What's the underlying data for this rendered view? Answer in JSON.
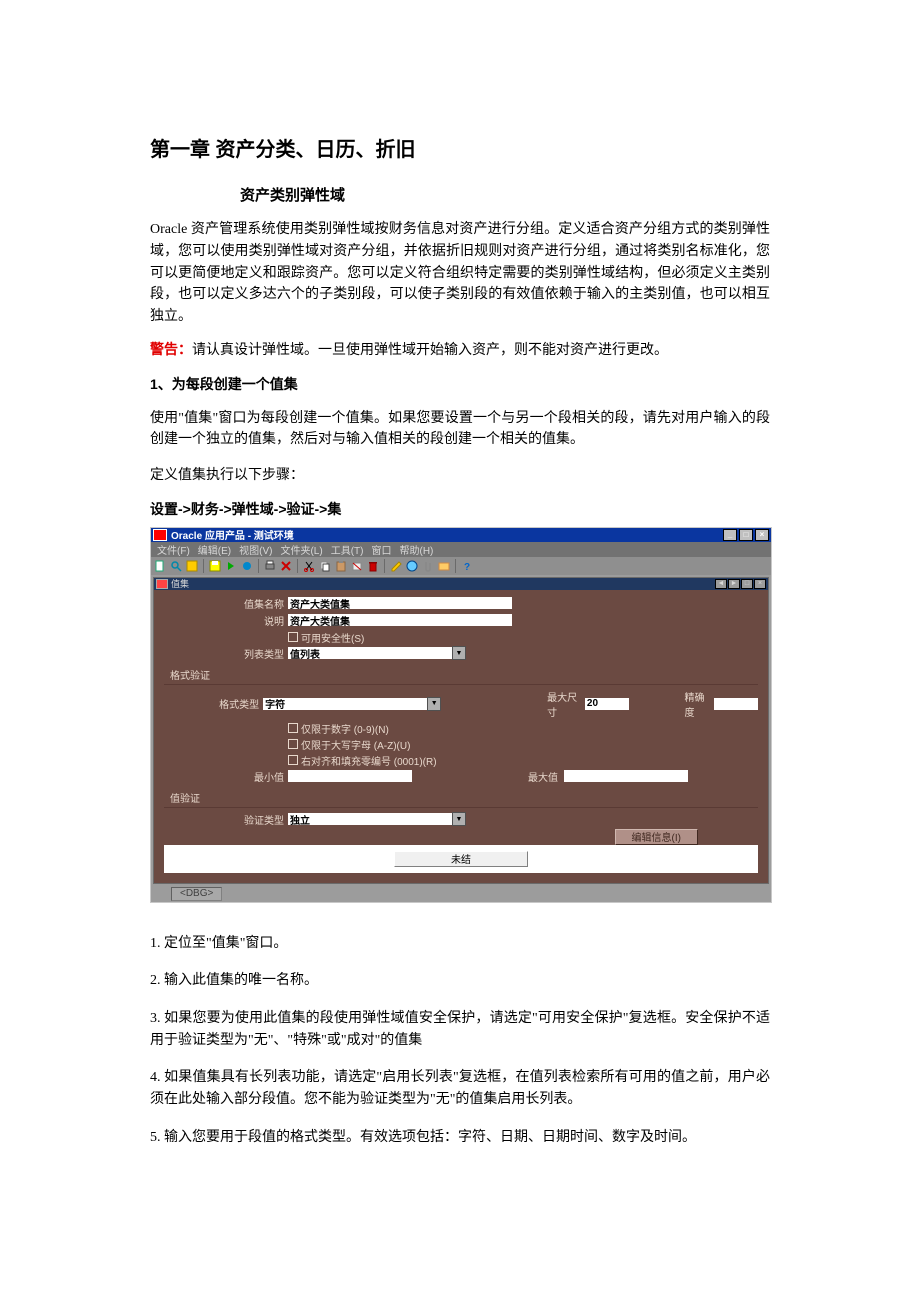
{
  "doc": {
    "chapter_title": "第一章 资产分类、日历、折旧",
    "section_title": "资产类别弹性域",
    "intro_para": "Oracle 资产管理系统使用类别弹性域按财务信息对资产进行分组。定义适合资产分组方式的类别弹性域，您可以使用类别弹性域对资产分组，并依据折旧规则对资产进行分组，通过将类别名标准化，您可以更简便地定义和跟踪资产。您可以定义符合组织特定需要的类别弹性域结构，但必须定义主类别段，也可以定义多达六个的子类别段，可以使子类别段的有效值依赖于输入的主类别值，也可以相互独立。",
    "warning_label": "警告：",
    "warning_text": "请认真设计弹性域。一旦使用弹性域开始输入资产，则不能对资产进行更改。",
    "sub_heading_1": "1、为每段创建一个值集",
    "sub_heading_1_para": "使用\"值集\"窗口为每段创建一个值集。如果您要设置一个与另一个段相关的段，请先对用户输入的段创建一个独立的值集，然后对与输入值相关的段创建一个相关的值集。",
    "define_steps_intro": "定义值集执行以下步骤：",
    "nav_path": "设置->财务->弹性域->验证->集",
    "steps": {
      "s1": "1. 定位至\"值集\"窗口。",
      "s2": "2. 输入此值集的唯一名称。",
      "s3": "3. 如果您要为使用此值集的段使用弹性域值安全保护，请选定\"可用安全保护\"复选框。安全保护不适用于验证类型为\"无\"、\"特殊\"或\"成对\"的值集",
      "s4": "4. 如果值集具有长列表功能，请选定\"启用长列表\"复选框，在值列表检索所有可用的值之前，用户必须在此处输入部分段值。您不能为验证类型为\"无\"的值集启用长列表。",
      "s5": "5. 输入您要用于段值的格式类型。有效选项包括：字符、日期、日期时间、数字及时间。"
    }
  },
  "app": {
    "window_title": "Oracle 应用产品 - 测试环境",
    "menubar": {
      "file": "文件(F)",
      "edit": "编辑(E)",
      "view": "视图(V)",
      "folder": "文件夹(L)",
      "tools": "工具(T)",
      "window": "窗口",
      "help": "帮助(H)"
    },
    "inner_title": "值集",
    "labels": {
      "valueset_name": "值集名称",
      "description": "说明",
      "security_checkbox": "可用安全性(S)",
      "list_type": "列表类型",
      "group_format": "格式验证",
      "format_type": "格式类型",
      "max_size": "最大尺寸",
      "precision": "精确度",
      "numbers_only": "仅限于数字 (0-9)(N)",
      "uppercase_only": "仅限于大写字母 (A-Z)(U)",
      "right_justify": "右对齐和填充零编号 (0001)(R)",
      "min_value": "最小值",
      "max_value": "最大值",
      "group_validation": "值验证",
      "validation_type": "验证类型",
      "edit_info_btn": "编辑信息(I)",
      "footer_btn": "未结"
    },
    "values": {
      "valueset_name": "资产大类值集",
      "description": "资产大类值集",
      "list_type": "值列表",
      "format_type": "字符",
      "max_size": "20",
      "precision": "",
      "min_value": "",
      "max_value": "",
      "validation_type": "独立"
    },
    "statusbar": "<DBG>"
  }
}
